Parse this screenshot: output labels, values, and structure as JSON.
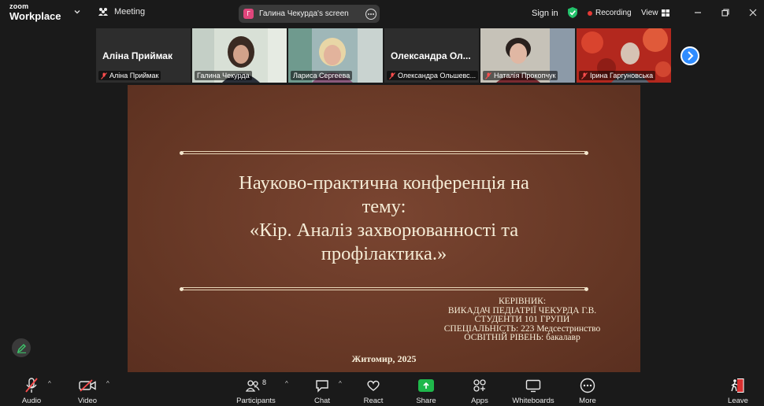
{
  "brand": {
    "zoom": "zoom",
    "product": "Workplace"
  },
  "meeting": {
    "label": "Meeting"
  },
  "share_pill": {
    "avatar_letter": "Г",
    "title": "Галина Чекурда's screen"
  },
  "header": {
    "sign_in": "Sign in",
    "recording": "Recording",
    "view": "View"
  },
  "participants_strip": [
    {
      "big_name": "Аліна Приймак",
      "label": "Аліна Приймак",
      "muted": true
    },
    {
      "label": "Галина Чекурда",
      "muted": false,
      "active": true
    },
    {
      "label": "Лариса Сергеева",
      "muted": false
    },
    {
      "big_name": "Олександра  Ол...",
      "label": "Олександра Ольшевс...",
      "muted": true
    },
    {
      "label": "Наталія Прокопчук",
      "muted": true
    },
    {
      "label": "Ірина Гаргуновська",
      "muted": true
    }
  ],
  "slide": {
    "title_lines": [
      "Науково-практична конференція на",
      "тему:",
      "«Кір. Аналіз захворюванності та",
      "профілактика.»"
    ],
    "info_lines": [
      "КЕРІВНИК:",
      "ВИКАДАЧ ПЕДІАТРІЇ ЧЕКУРДА Г.В.",
      "СТУДЕНТИ 101 ГРУПИ",
      "СПЕЦІАЛЬНІСТЬ: 223 Медсестринство",
      "ОСВІТНІЙ РІВЕНЬ: бакалавр"
    ],
    "footer": "Житомир, 2025"
  },
  "toolbar": {
    "audio": "Audio",
    "video": "Video",
    "participants": "Participants",
    "participants_count": "8",
    "chat": "Chat",
    "react": "React",
    "share": "Share",
    "apps": "Apps",
    "whiteboards": "Whiteboards",
    "more": "More",
    "leave": "Leave"
  },
  "colors": {
    "accent_share": "#1fb84b",
    "active_speaker": "#3ecf6e",
    "recording": "#e53935",
    "strip_next": "#2f8cff"
  }
}
